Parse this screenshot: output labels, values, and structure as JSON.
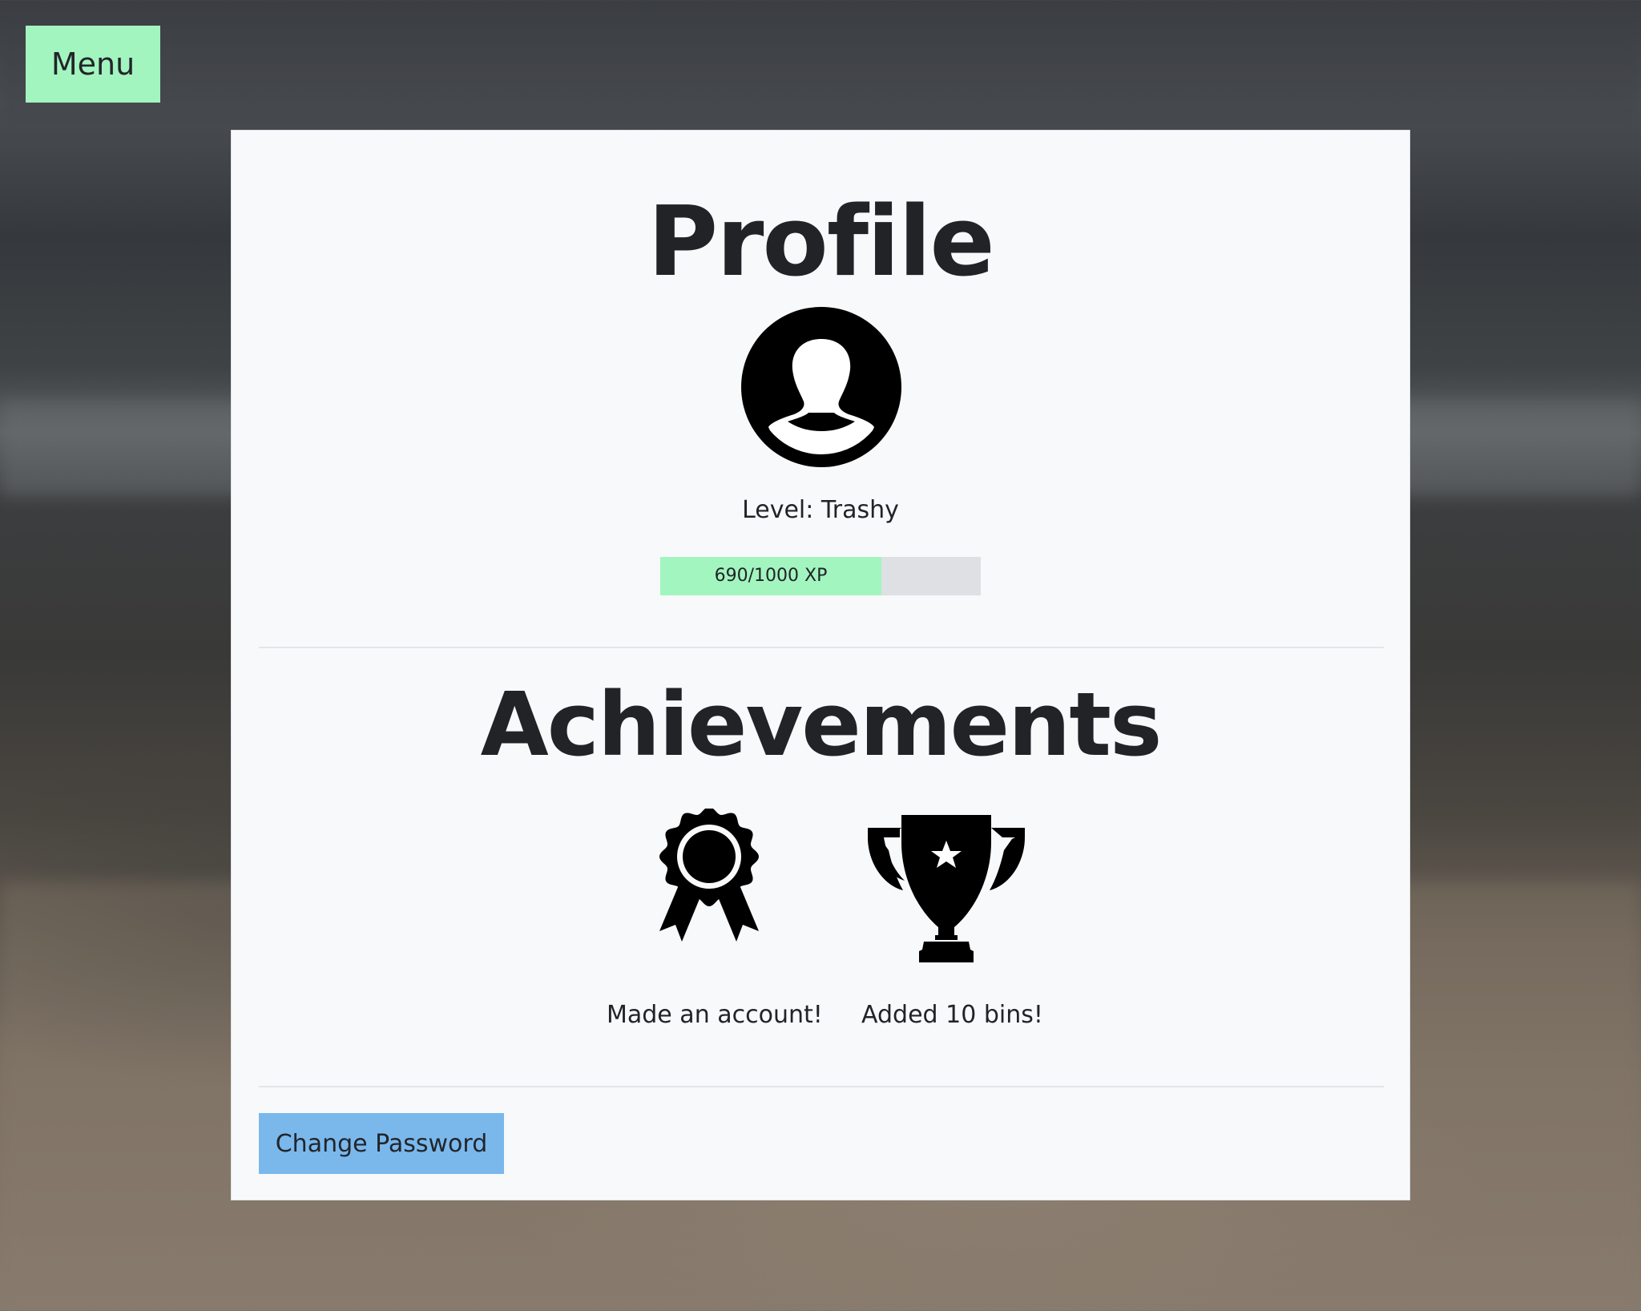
{
  "menu": {
    "label": "Menu"
  },
  "profile": {
    "title": "Profile",
    "level_text": "Level: Trashy",
    "xp": {
      "label": "690/1000 XP",
      "current": 690,
      "max": 1000,
      "fill_color": "#a2f5bf",
      "track_color": "#dee0e4"
    }
  },
  "achievements": {
    "title": "Achievements",
    "items": [
      {
        "icon": "award-ribbon-icon",
        "label": "Made an account!"
      },
      {
        "icon": "trophy-icon",
        "label": "Added 10 bins!"
      }
    ]
  },
  "actions": {
    "change_password_label": "Change Password"
  },
  "colors": {
    "menu_button": "#a2f5bf",
    "change_password_button": "#7ab8ec",
    "card_background": "#f8f9fb",
    "text": "#212327"
  }
}
